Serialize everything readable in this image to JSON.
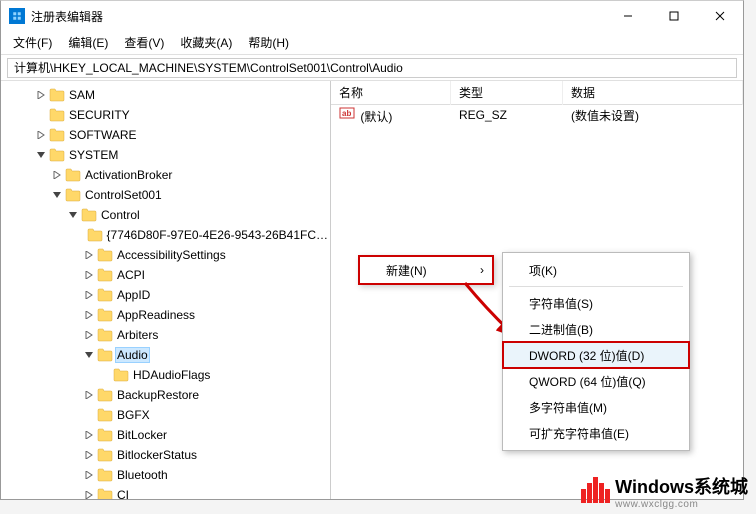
{
  "window": {
    "title": "注册表编辑器"
  },
  "menu": {
    "file": "文件(F)",
    "edit": "编辑(E)",
    "view": "查看(V)",
    "favorites": "收藏夹(A)",
    "help": "帮助(H)"
  },
  "address": {
    "path": "计算机\\HKEY_LOCAL_MACHINE\\SYSTEM\\ControlSet001\\Control\\Audio"
  },
  "sidebar_visible": [
    {
      "indent": 2,
      "exp": ">",
      "label": "SAM"
    },
    {
      "indent": 2,
      "exp": "",
      "label": "SECURITY"
    },
    {
      "indent": 2,
      "exp": ">",
      "label": "SOFTWARE"
    },
    {
      "indent": 2,
      "exp": "v",
      "label": "SYSTEM"
    },
    {
      "indent": 3,
      "exp": ">",
      "label": "ActivationBroker"
    },
    {
      "indent": 3,
      "exp": "v",
      "label": "ControlSet001"
    },
    {
      "indent": 4,
      "exp": "v",
      "label": "Control"
    },
    {
      "indent": 5,
      "exp": "",
      "label": "{7746D80F-97E0-4E26-9543-26B41FC…"
    },
    {
      "indent": 5,
      "exp": ">",
      "label": "AccessibilitySettings"
    },
    {
      "indent": 5,
      "exp": ">",
      "label": "ACPI"
    },
    {
      "indent": 5,
      "exp": ">",
      "label": "AppID"
    },
    {
      "indent": 5,
      "exp": ">",
      "label": "AppReadiness"
    },
    {
      "indent": 5,
      "exp": ">",
      "label": "Arbiters"
    },
    {
      "indent": 5,
      "exp": "v",
      "label": "Audio",
      "selected": true
    },
    {
      "indent": 6,
      "exp": "",
      "label": "HDAudioFlags"
    },
    {
      "indent": 5,
      "exp": ">",
      "label": "BackupRestore"
    },
    {
      "indent": 5,
      "exp": "",
      "label": "BGFX"
    },
    {
      "indent": 5,
      "exp": ">",
      "label": "BitLocker"
    },
    {
      "indent": 5,
      "exp": ">",
      "label": "BitlockerStatus"
    },
    {
      "indent": 5,
      "exp": ">",
      "label": "Bluetooth"
    },
    {
      "indent": 5,
      "exp": ">",
      "label": "CI"
    }
  ],
  "list": {
    "headers": {
      "name": "名称",
      "type": "类型",
      "data": "数据"
    },
    "rows": [
      {
        "icon": "ab",
        "name": "(默认)",
        "type": "REG_SZ",
        "data": "(数值未设置)"
      }
    ]
  },
  "context_menu": {
    "new": "新建(N)"
  },
  "submenu": {
    "key": "项(K)",
    "string": "字符串值(S)",
    "binary": "二进制值(B)",
    "dword": "DWORD (32 位)值(D)",
    "qword": "QWORD (64 位)值(Q)",
    "multi": "多字符串值(M)",
    "expand": "可扩充字符串值(E)"
  },
  "watermark": {
    "title": "Windows系统城",
    "url": "www.wxclgg.com"
  }
}
